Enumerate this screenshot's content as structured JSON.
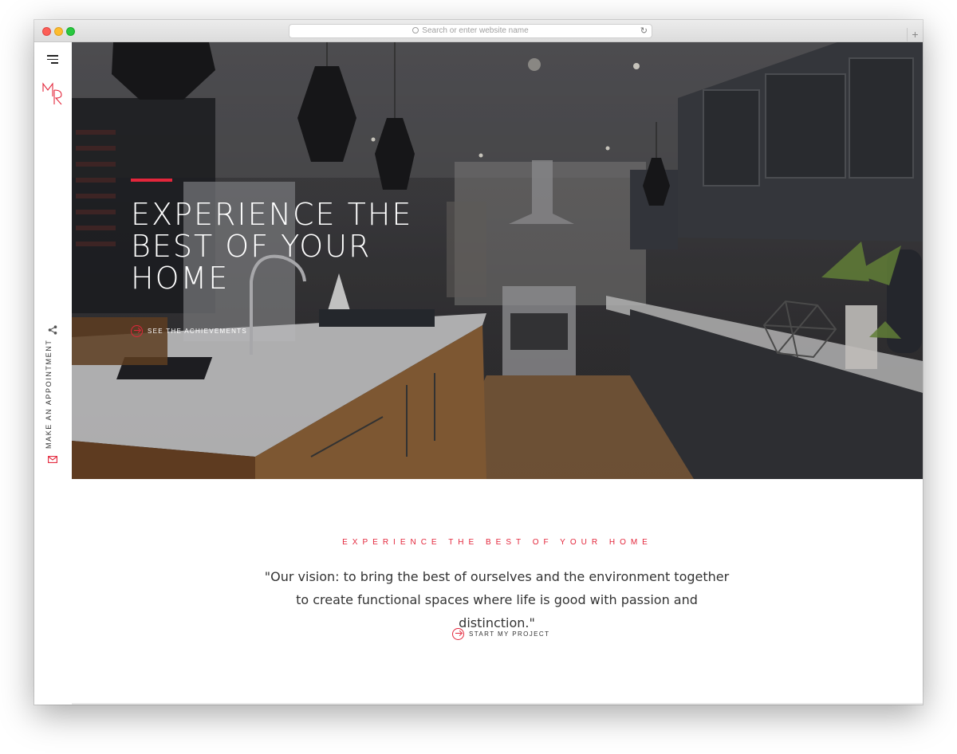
{
  "browser": {
    "url_placeholder": "Search or enter website name",
    "new_tab_label": "+"
  },
  "sidebar": {
    "appointment_label": "MAKE AN APPOINTMENT",
    "logo_text": "MR"
  },
  "hero": {
    "title": "EXPERIENCE THE BEST OF YOUR HOME",
    "cta_label": "SEE THE ACHIEVEMENTS"
  },
  "intro": {
    "eyebrow": "EXPERIENCE THE BEST OF YOUR HOME",
    "quote": "\"Our vision: to bring the best of ourselves and the environment together to create functional spaces where life is good with passion and distinction.\"",
    "cta_label": "START MY PROJECT"
  },
  "colors": {
    "accent": "#e3263b",
    "text_dark": "#333333"
  },
  "icons": [
    "menu-icon",
    "logo-icon",
    "share-icon",
    "mail-icon",
    "arrow-circle-icon",
    "search-icon",
    "reload-icon"
  ]
}
